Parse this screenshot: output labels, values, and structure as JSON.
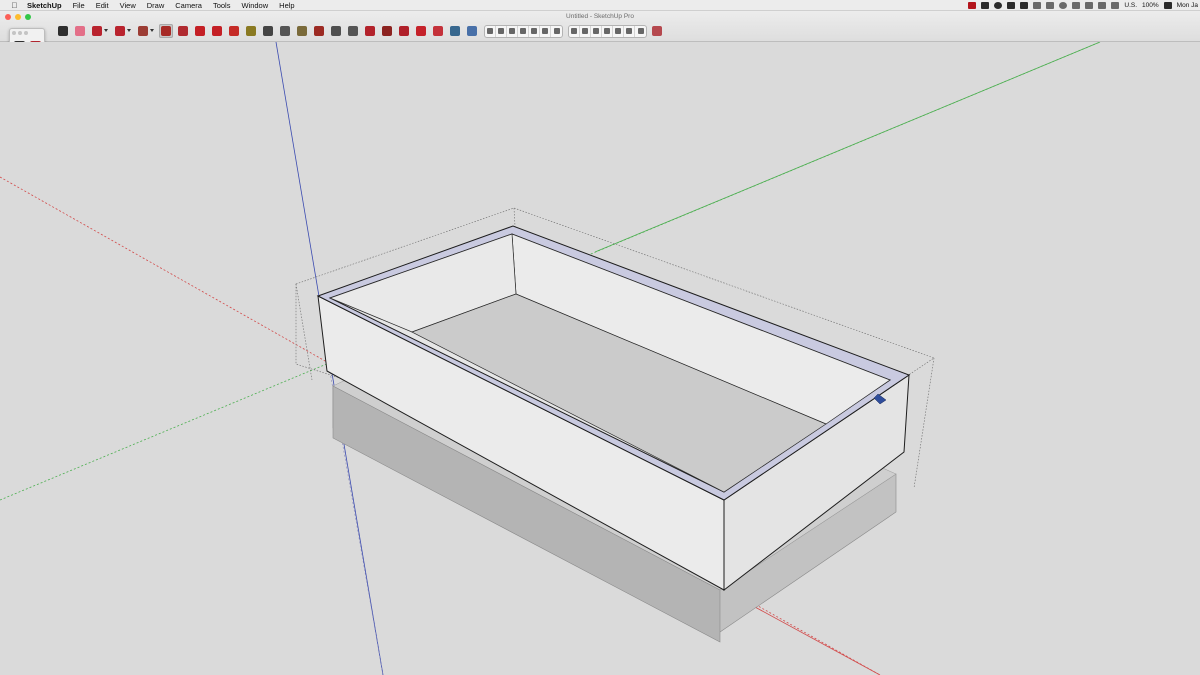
{
  "menubar": {
    "apple_label": "",
    "app_name": "SketchUp",
    "items": [
      "File",
      "Edit",
      "View",
      "Draw",
      "Camera",
      "Tools",
      "Window",
      "Help"
    ],
    "status": {
      "keyboard_region": "U.S.",
      "zoom": "100%",
      "clock": "Mon Ja"
    }
  },
  "window": {
    "title": "Untitled - SketchUp Pro"
  },
  "toolbar": {
    "tools": [
      {
        "name": "select-icon",
        "color": "#2e2e2e"
      },
      {
        "name": "eraser-icon",
        "color": "#e36f88"
      },
      {
        "name": "pencil-line-icon",
        "color": "#b9232e"
      },
      {
        "name": "arc-icon",
        "color": "#b9232e"
      },
      {
        "name": "rectangle-icon",
        "color": "#9c3d35"
      },
      {
        "name": "push-pull-icon",
        "color": "#a72a26"
      },
      {
        "name": "offset-icon",
        "color": "#b02a30"
      },
      {
        "name": "move-icon",
        "color": "#c41f25"
      },
      {
        "name": "rotate-icon",
        "color": "#c41f25"
      },
      {
        "name": "scale-icon",
        "color": "#c52b27"
      },
      {
        "name": "tape-measure-icon",
        "color": "#8a7a22"
      },
      {
        "name": "dimension-icon",
        "color": "#444444"
      },
      {
        "name": "text-icon",
        "color": "#555555"
      },
      {
        "name": "paint-bucket-icon",
        "color": "#7a6a3a"
      },
      {
        "name": "orbit-icon",
        "color": "#9c2a23"
      },
      {
        "name": "pan-icon",
        "color": "#4f4f4f"
      },
      {
        "name": "zoom-icon",
        "color": "#555555"
      },
      {
        "name": "zoom-extents-icon",
        "color": "#b3222b"
      },
      {
        "name": "warehouse-icon",
        "color": "#8c2320"
      },
      {
        "name": "extension-warehouse-icon",
        "color": "#b0202a"
      },
      {
        "name": "share-model-icon",
        "color": "#c5222a"
      },
      {
        "name": "layout-icon",
        "color": "#c4313a"
      },
      {
        "name": "preview-icon",
        "color": "#38688f"
      },
      {
        "name": "extension-manager-icon",
        "color": "#4870a8"
      }
    ],
    "style_buttons": [
      "xray-icon",
      "back-edges-icon",
      "wireframe-icon",
      "hidden-line-icon",
      "shaded-icon",
      "shaded-textures-icon",
      "monochrome-icon"
    ],
    "view_buttons": [
      "iso-view-icon",
      "top-view-icon",
      "front-view-icon",
      "right-view-icon",
      "back-view-icon",
      "left-view-icon",
      "bottom-view-icon"
    ],
    "trailing_tool": {
      "name": "solid-tools-icon",
      "color": "#b5484e"
    }
  },
  "palette": {
    "tools": [
      [
        "select-icon",
        "#2f2f2f"
      ],
      [
        "make-component-icon",
        "#b0262f"
      ],
      [
        "paint-bucket-icon",
        "#8a7431"
      ],
      [
        "eraser-icon",
        "#e07090"
      ],
      [
        "line-icon",
        "#b4232b"
      ],
      [
        "freehand-icon",
        "#b4232b"
      ],
      [
        "rectangle-icon",
        "#a7443d"
      ],
      [
        "rotated-rectangle-icon",
        "#a7443d"
      ],
      [
        "circle-icon",
        "#b03a35"
      ],
      [
        "polygon-icon",
        "#b03a35"
      ],
      [
        "arc-icon",
        "#b4232b"
      ],
      [
        "two-point-arc-icon",
        "#b4232b"
      ],
      [
        "three-point-arc-icon",
        "#b4232b"
      ],
      [
        "pie-icon",
        "#a7443d"
      ],
      [
        "move-icon",
        "#c41f25"
      ],
      [
        "push-pull-icon",
        "#6a3a30"
      ],
      [
        "rotate-icon",
        "#c41f25"
      ],
      [
        "follow-me-icon",
        "#a82a2a"
      ],
      [
        "scale-icon",
        "#c52b27"
      ],
      [
        "offset-icon",
        "#b02a30"
      ],
      [
        "tape-measure-icon",
        "#8a7a22"
      ],
      [
        "dimension-icon",
        "#444444"
      ],
      [
        "protractor-icon",
        "#8a7a22"
      ],
      [
        "text-icon",
        "#555555"
      ],
      [
        "axes-icon",
        "#b4232b"
      ],
      [
        "3d-text-icon",
        "#555555"
      ],
      [
        "orbit-icon",
        "#9c2a23"
      ],
      [
        "pan-icon",
        "#4f4f4f"
      ],
      [
        "zoom-icon",
        "#555555"
      ],
      [
        "zoom-window-icon",
        "#b3222b"
      ],
      [
        "zoom-extents-icon",
        "#b3222b"
      ],
      [
        "previous-view-icon",
        "#38688f"
      ],
      [
        "position-camera-icon",
        "#444444"
      ],
      [
        "walk-icon",
        "#333333"
      ],
      [
        "look-around-icon",
        "#444444"
      ],
      [
        "section-plane-icon",
        "#444444"
      ]
    ]
  },
  "scene": {
    "axis_colors": {
      "red": "#d24a4a",
      "green": "#4caf50",
      "blue": "#3b4bb0"
    },
    "face_colors": {
      "top_rim": "#c8c9e0",
      "outer_wall": "#ebebeb",
      "inner_wall": "#e6e6e6",
      "floor": "#cbcbcb",
      "shadow": "#bdbdbd"
    }
  }
}
